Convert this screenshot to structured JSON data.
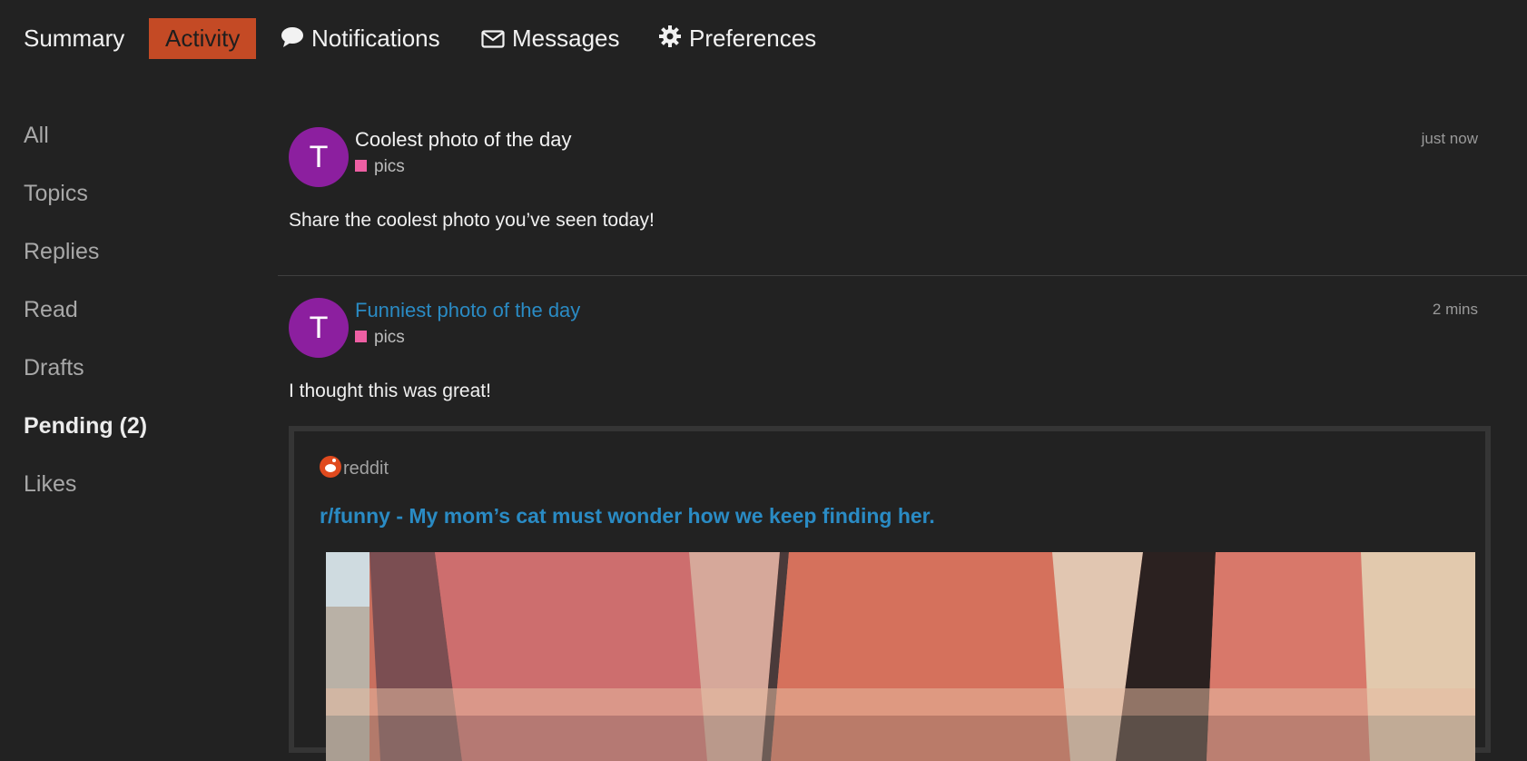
{
  "top_tabs": [
    {
      "label": "Summary",
      "icon": ""
    },
    {
      "label": "Activity",
      "icon": "",
      "active": true
    },
    {
      "label": "Notifications",
      "icon": "speech-bubble-icon"
    },
    {
      "label": "Messages",
      "icon": "envelope-icon"
    },
    {
      "label": "Preferences",
      "icon": "gear-icon"
    }
  ],
  "sidebar": {
    "items": [
      "All",
      "Topics",
      "Replies",
      "Read",
      "Drafts",
      "Pending (2)",
      "Likes"
    ]
  },
  "posts": [
    {
      "avatar_letter": "T",
      "title": "Coolest photo of the day",
      "category": "pics",
      "time": "just now",
      "body": "Share the coolest photo you’ve seen today!"
    },
    {
      "avatar_letter": "T",
      "title": "Funniest photo of the day",
      "category": "pics",
      "time": "2 mins",
      "body": "I thought this was great!",
      "onebox": {
        "source": "reddit",
        "title": "r/funny - My mom’s cat must wonder how we keep finding her."
      }
    }
  ],
  "colors": {
    "background": "#222222",
    "accent": "#c44a25",
    "avatar": "#8c1f9f",
    "category_pics": "#ee5fa3",
    "link": "#2a8bc4"
  }
}
